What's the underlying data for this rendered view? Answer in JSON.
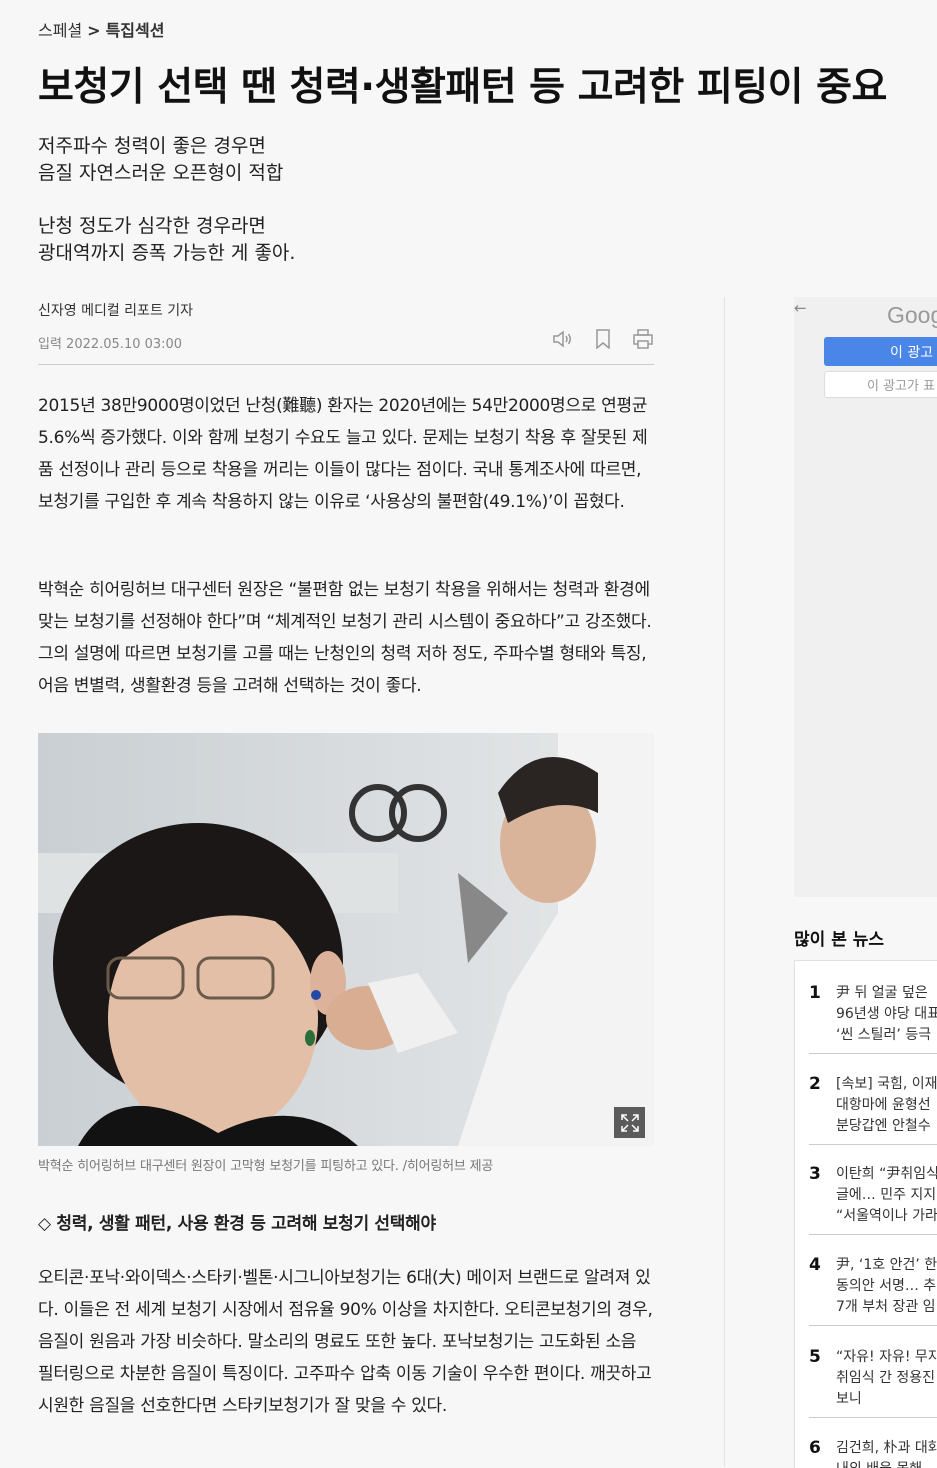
{
  "breadcrumb": {
    "section": "스페셜",
    "separator": ">",
    "current": "특집섹션"
  },
  "headline": "보청기 선택 땐 청력·생활패턴 등 고려한 피팅이 중요",
  "subheadlines": [
    "저주파수 청력이 좋은 경우면\n음질 자연스러운 오픈형이 적합",
    "난청 정도가 심각한 경우라면\n광대역까지 증폭 가능한 게 좋아."
  ],
  "byline": {
    "author": "신자영 메디컬 리포트 기자",
    "published": "입력 2022.05.10 03:00"
  },
  "tools": [
    "speaker-icon",
    "bookmark-icon",
    "print-icon"
  ],
  "paragraphs": [
    "2015년 38만9000명이었던 난청(難聽) 환자는 2020년에는 54만2000명으로 연평균 5.6%씩 증가했다. 이와 함께 보청기 수요도 늘고 있다. 문제는 보청기 착용 후 잘못된 제품 선정이나 관리 등으로 착용을 꺼리는 이들이 많다는 점이다. 국내 통계조사에 따르면, 보청기를 구입한 후 계속 착용하지 않는 이유로 ‘사용상의 불편함(49.1%)’이 꼽혔다.",
    "박혁순 히어링허브 대구센터 원장은 “불편함 없는 보청기 착용을 위해서는 청력과 환경에 맞는 보청기를 선정해야 한다”며 “체계적인 보청기 관리 시스템이 중요하다”고 강조했다. 그의 설명에 따르면 보청기를 고를 때는 난청인의 청력 저하 정도, 주파수별 형태와 특징, 어음 변별력, 생활환경 등을 고려해 선택하는 것이 좋다.",
    "오티콘·포낙·와이덱스·스타키·벨톤·시그니아보청기는 6대(大) 메이저 브랜드로 알려져 있다. 이들은 전 세계 보청기 시장에서 점유율 90% 이상을 차지한다. 오티콘보청기의 경우, 음질이 원음과 가장 비슷하다. 말소리의 명료도 또한 높다. 포낙보청기는 고도화된 소음 필터링으로 차분한 음질이 특징이다. 고주파수 압축 이동 기술이 우수한 편이다. 깨끗하고 시원한 음질을 선호한다면 스타키보청기가 잘 맞을 수 있다."
  ],
  "photo_caption": "박혁순 히어링허브 대구센터 원장이 고막형 보청기를 피팅하고 있다. /히어링허브 제공",
  "section_heading": "◇ 청력, 생활 패턴, 사용 환경 등 고려해 보청기 선택해야",
  "ad": {
    "back": "←",
    "logo": "Goog",
    "button_primary": "이 광고",
    "button_secondary": "이 광고가 표"
  },
  "popular": {
    "title": "많이 본 뉴스",
    "items": [
      {
        "rank": "1",
        "text": "尹 뒤 얼굴 덮은 \n96년생 야당 대표\n‘씬 스틸러’ 등극"
      },
      {
        "rank": "2",
        "text": "[속보] 국힘, 이재\n대항마에 윤형선\n분당갑엔 안철수"
      },
      {
        "rank": "3",
        "text": "이탄희 “尹취임식\n글에… 민주 지지\n“서울역이나 가라"
      },
      {
        "rank": "4",
        "text": "尹, ‘1호 안건’ 한\n동의안 서명… 추\n7개 부처 장관 임"
      },
      {
        "rank": "5",
        "text": "“자유! 자유! 무지\n취임식 간 정용진\n보니"
      },
      {
        "rank": "6",
        "text": "김건희, 朴과 대화\n내외 배웅 못해"
      }
    ]
  },
  "colors": {
    "background": "#f7f7f7",
    "ad_button": "#4a86e8",
    "rule": "#cccccc"
  }
}
